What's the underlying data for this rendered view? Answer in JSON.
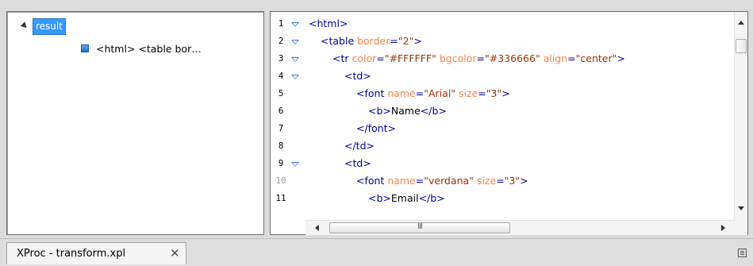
{
  "tree": {
    "root_label": "result",
    "child_label": "<html>  <table bor…"
  },
  "editor": {
    "lines": [
      {
        "num": "1",
        "fold": true,
        "indent": 0,
        "parts": [
          [
            "tag",
            "<html>"
          ]
        ]
      },
      {
        "num": "2",
        "fold": true,
        "indent": 1,
        "parts": [
          [
            "tag",
            "<table "
          ],
          [
            "attr",
            "border"
          ],
          [
            "tag",
            "="
          ],
          [
            "val",
            "\"2\""
          ],
          [
            "tag",
            ">"
          ]
        ]
      },
      {
        "num": "3",
        "fold": true,
        "indent": 2,
        "parts": [
          [
            "tag",
            "<tr "
          ],
          [
            "attr",
            "color"
          ],
          [
            "tag",
            "="
          ],
          [
            "val",
            "\"#FFFFFF\""
          ],
          [
            "tag",
            " "
          ],
          [
            "attr",
            "bgcolor"
          ],
          [
            "tag",
            "="
          ],
          [
            "val",
            "\"#336666\""
          ],
          [
            "tag",
            " "
          ],
          [
            "attr",
            "align"
          ],
          [
            "tag",
            "="
          ],
          [
            "val",
            "\"center\""
          ],
          [
            "tag",
            ">"
          ]
        ]
      },
      {
        "num": "4",
        "fold": true,
        "indent": 3,
        "parts": [
          [
            "tag",
            "<td>"
          ]
        ]
      },
      {
        "num": "5",
        "fold": false,
        "indent": 4,
        "parts": [
          [
            "tag",
            "<font "
          ],
          [
            "attr",
            "name"
          ],
          [
            "tag",
            "="
          ],
          [
            "val",
            "\"Arial\""
          ],
          [
            "tag",
            " "
          ],
          [
            "attr",
            "size"
          ],
          [
            "tag",
            "="
          ],
          [
            "val",
            "\"3\""
          ],
          [
            "tag",
            ">"
          ]
        ]
      },
      {
        "num": "6",
        "fold": false,
        "indent": 5,
        "parts": [
          [
            "tag",
            "<b>"
          ],
          [
            "txt",
            "Name"
          ],
          [
            "tag",
            "</b>"
          ]
        ]
      },
      {
        "num": "7",
        "fold": false,
        "indent": 4,
        "parts": [
          [
            "tag",
            "</font>"
          ]
        ]
      },
      {
        "num": "8",
        "fold": false,
        "indent": 3,
        "parts": [
          [
            "tag",
            "</td>"
          ]
        ]
      },
      {
        "num": "9",
        "fold": true,
        "indent": 3,
        "parts": [
          [
            "tag",
            "<td>"
          ]
        ]
      },
      {
        "num": "10",
        "fold": false,
        "grey": true,
        "indent": 4,
        "parts": [
          [
            "tag",
            "<font "
          ],
          [
            "attr",
            "name"
          ],
          [
            "tag",
            "="
          ],
          [
            "val",
            "\"verdana\""
          ],
          [
            "tag",
            " "
          ],
          [
            "attr",
            "size"
          ],
          [
            "tag",
            "="
          ],
          [
            "val",
            "\"3\""
          ],
          [
            "tag",
            ">"
          ]
        ]
      },
      {
        "num": "11",
        "fold": false,
        "indent": 5,
        "parts": [
          [
            "tag",
            "<b>"
          ],
          [
            "txt",
            "Email"
          ],
          [
            "tag",
            "</b>"
          ]
        ]
      }
    ],
    "hscroll_grip": "III"
  },
  "tabs": {
    "active_label": "XProc - transform.xpl",
    "close_glyph": "✕"
  },
  "colors": {
    "tag": "#000096",
    "attribute": "#f5844c",
    "value": "#993300",
    "selection": "#3399ff"
  },
  "icons": {
    "tree_node": "xml-node-icon",
    "fold": "fold-triangle-icon",
    "tab_menu": "view-menu-icon"
  }
}
